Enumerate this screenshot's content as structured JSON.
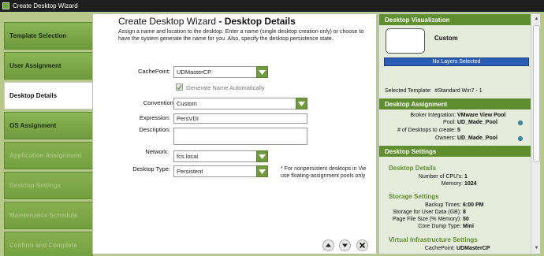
{
  "window": {
    "title": "Create Desktop Wizard"
  },
  "nav": {
    "items": [
      {
        "label": "Template Selection",
        "state": "enabled"
      },
      {
        "label": "User Assignment",
        "state": "enabled"
      },
      {
        "label": "Desktop Details",
        "state": "active"
      },
      {
        "label": "OS Assignment",
        "state": "enabled"
      },
      {
        "label": "Application Assignment",
        "state": "disabled"
      },
      {
        "label": "Desktop Settings",
        "state": "disabled"
      },
      {
        "label": "Maintenance Schedule",
        "state": "disabled"
      },
      {
        "label": "Confirm and Complete",
        "state": "disabled"
      }
    ]
  },
  "main": {
    "title_prefix": "Create Desktop Wizard",
    "title_suffix": " - Desktop Details",
    "description": "Assign a name and location to the desktop. Enter a name (single desktop creation only) or choose to have the system generate the name for you. Also, specify the desktop persistence state.",
    "cachepoint": {
      "label": "CachePoint:",
      "value": "UDMasterCP"
    },
    "generate_name": {
      "label": "Generate Name Automatically",
      "checked": true
    },
    "convention_name": {
      "label": "Convention Name:",
      "value": "Custom"
    },
    "expression": {
      "label": "Expression:",
      "value": "PersVDI"
    },
    "description_field": {
      "label": "Description:",
      "value": ""
    },
    "network": {
      "label": "Network:",
      "value": "fcs.local"
    },
    "desktop_type": {
      "label": "Desktop Type:",
      "value": "Persistent"
    },
    "note_line1": "* For nonpersistent desktops in Vie",
    "note_line2": "use floating-assignment pools only"
  },
  "right": {
    "viz_header": "Desktop Visualization",
    "viz_name": "Custom",
    "layers_bar": "No Layers Selected",
    "selected_template_label": "Selected Template:",
    "selected_template_value": "#Standard Win7 - 1",
    "assignment_header": "Desktop Assignment",
    "assignment": [
      {
        "key": "Broker Integration:",
        "value": "VMware View Pool",
        "has_dot": false
      },
      {
        "key": "Pool:",
        "value": "UD_Made_Pool",
        "has_dot": true
      },
      {
        "key": "# of Desktops to create:",
        "value": "5",
        "has_dot": false
      },
      {
        "key": "Owners:",
        "value": "UD_Made_Pool",
        "has_dot": true
      }
    ],
    "settings_header": "Desktop Settings",
    "details_subhead": "Desktop Details",
    "details": [
      {
        "key": "Number of CPU's:",
        "value": "1"
      },
      {
        "key": "Memory:",
        "value": "1024"
      }
    ],
    "storage_subhead": "Storage Settings",
    "storage": [
      {
        "key": "Backup Times:",
        "value": "6:00 PM"
      },
      {
        "key": "Storage for User Data (GB):",
        "value": "8"
      },
      {
        "key": "Page File Size (% Memory):",
        "value": "50"
      },
      {
        "key": "Core Dump Type:",
        "value": "Mini"
      }
    ],
    "virtual_subhead": "Virtual Infrastructure Settings",
    "virtual": [
      {
        "key": "CachePoint:",
        "value": "UDMasterCP"
      }
    ]
  },
  "colors": {
    "accent_green": "#6f9a3d",
    "header_green": "#5f8e2e",
    "layers_blue": "#2a5db5",
    "info_dot": "#3a8fb0"
  }
}
